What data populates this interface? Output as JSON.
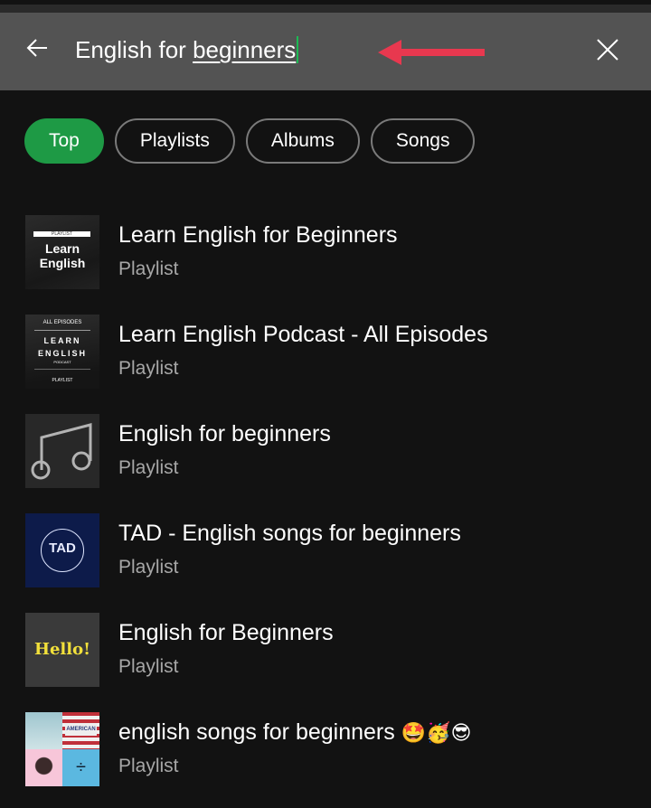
{
  "search": {
    "query_plain": "English for ",
    "query_underlined": "beginners",
    "back_icon": "arrow-left",
    "clear_icon": "close-x",
    "annotation_arrow_color": "#e8384f"
  },
  "filters": [
    {
      "label": "Top",
      "active": true
    },
    {
      "label": "Playlists",
      "active": false
    },
    {
      "label": "Albums",
      "active": false
    },
    {
      "label": "Songs",
      "active": false
    }
  ],
  "colors": {
    "accent": "#1e9a45",
    "background": "#121212",
    "searchbar": "#535353",
    "subtext": "#a7a7a7"
  },
  "results": [
    {
      "title": "Learn English for Beginners",
      "type": "Playlist",
      "art": {
        "tag": "PLAYLIST",
        "line1": "Learn",
        "line2": "English"
      }
    },
    {
      "title": "Learn English Podcast - All Episodes",
      "type": "Playlist",
      "art": {
        "top": "ALL EPISODES",
        "line1": "LEARN",
        "line2": "ENGLISH",
        "line3": "PODCAST",
        "bottom": "PLAYLIST"
      }
    },
    {
      "title": "English for beginners",
      "type": "Playlist",
      "art": {
        "icon": "music-note"
      }
    },
    {
      "title": "TAD - English songs for beginners",
      "type": "Playlist",
      "art": {
        "text": "TAD"
      }
    },
    {
      "title": "English for Beginners",
      "type": "Playlist",
      "art": {
        "text": "Hello!"
      }
    },
    {
      "title": "english songs for beginners",
      "emoji": "🤩🥳😎",
      "type": "Playlist",
      "art": {
        "mosaic": true
      }
    }
  ]
}
